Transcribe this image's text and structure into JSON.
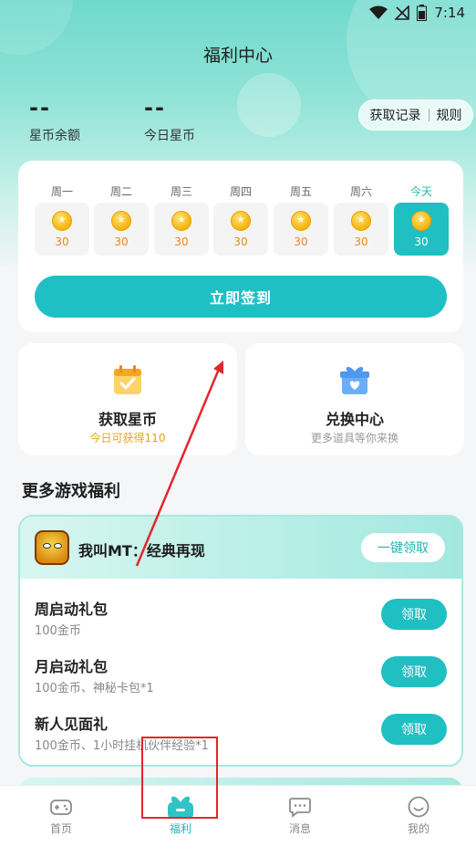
{
  "status_bar": {
    "time": "7:14",
    "icons": [
      "wifi-icon",
      "no-signal-icon",
      "battery-icon"
    ]
  },
  "header": {
    "title": "福利中心"
  },
  "stats": {
    "balance": {
      "value": "--",
      "label": "星币余额"
    },
    "today": {
      "value": "--",
      "label": "今日星币"
    }
  },
  "record_menu": {
    "record_label": "获取记录",
    "rules_label": "规则"
  },
  "sign_in": {
    "days": [
      {
        "label": "周一",
        "amount": "30"
      },
      {
        "label": "周二",
        "amount": "30"
      },
      {
        "label": "周三",
        "amount": "30"
      },
      {
        "label": "周四",
        "amount": "30"
      },
      {
        "label": "周五",
        "amount": "30"
      },
      {
        "label": "周六",
        "amount": "30"
      },
      {
        "label": "今天",
        "amount": "30"
      }
    ],
    "button_label": "立即签到"
  },
  "features": {
    "earn": {
      "title": "获取星币",
      "subtitle": "今日可获得110"
    },
    "exchange": {
      "title": "兑换中心",
      "subtitle": "更多道具等你来换"
    }
  },
  "more_games": {
    "section_title": "更多游戏福利",
    "game": {
      "name": "我叫MT：经典再现",
      "oneclick_label": "一键领取",
      "gifts": [
        {
          "name": "周启动礼包",
          "desc": "100金币",
          "button": "领取"
        },
        {
          "name": "月启动礼包",
          "desc": "100金币、神秘卡包*1",
          "button": "领取"
        },
        {
          "name": "新人见面礼",
          "desc": "100金币、1小时挂机伙伴经验*1",
          "button": "领取"
        }
      ]
    }
  },
  "tabbar": {
    "tabs": [
      {
        "label": "首页",
        "icon": "gamepad-icon"
      },
      {
        "label": "福利",
        "icon": "gift-icon",
        "active": true
      },
      {
        "label": "消息",
        "icon": "message-icon"
      },
      {
        "label": "我的",
        "icon": "smiley-icon"
      }
    ]
  },
  "colors": {
    "accent": "#1fbfc2",
    "coin_text": "#e78b1f",
    "annotation": "#e3262d"
  }
}
